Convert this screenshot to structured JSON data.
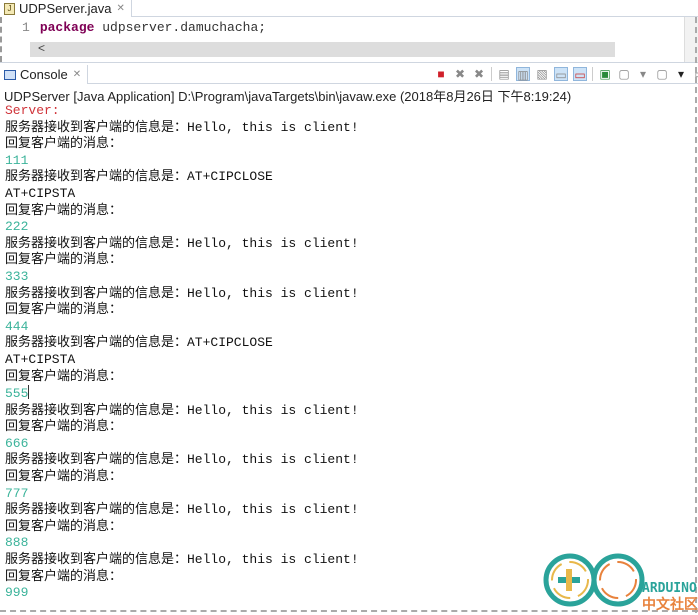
{
  "editor": {
    "tab_label": "UDPServer.java",
    "line_number": "1",
    "keyword": "package",
    "code_rest": " udpserver.damuchacha;",
    "scroll_left": "<"
  },
  "console": {
    "tab_label": "Console",
    "launch_info": "UDPServer [Java Application] D:\\Program\\javaTargets\\bin\\javaw.exe (2018年8月26日 下午8:19:24)",
    "toolbar": [
      "terminate",
      "remove-launch",
      "remove-all",
      "clear-console",
      "scroll-lock",
      "word-wrap",
      "show-on-stdout",
      "show-on-stderr",
      "pin-console",
      "display-selected-console",
      "open-console"
    ],
    "lines": [
      {
        "text": "Server:",
        "kind": "red"
      },
      {
        "text": "服务器接收到客户端的信息是：Hello, this is client!",
        "kind": "out"
      },
      {
        "text": "回复客户端的消息：",
        "kind": "out"
      },
      {
        "text": "111",
        "kind": "in"
      },
      {
        "text": "服务器接收到客户端的信息是：AT+CIPCLOSE",
        "kind": "out"
      },
      {
        "text": "AT+CIPSTA",
        "kind": "out"
      },
      {
        "text": "回复客户端的消息：",
        "kind": "out"
      },
      {
        "text": "222",
        "kind": "in"
      },
      {
        "text": "服务器接收到客户端的信息是：Hello, this is client!",
        "kind": "out"
      },
      {
        "text": "回复客户端的消息：",
        "kind": "out"
      },
      {
        "text": "333",
        "kind": "in"
      },
      {
        "text": "服务器接收到客户端的信息是：Hello, this is client!",
        "kind": "out"
      },
      {
        "text": "回复客户端的消息：",
        "kind": "out"
      },
      {
        "text": "444",
        "kind": "in"
      },
      {
        "text": "服务器接收到客户端的信息是：AT+CIPCLOSE",
        "kind": "out"
      },
      {
        "text": "AT+CIPSTA",
        "kind": "out"
      },
      {
        "text": "回复客户端的消息：",
        "kind": "out"
      },
      {
        "text": "555",
        "kind": "in",
        "cursor": true
      },
      {
        "text": "服务器接收到客户端的信息是：Hello, this is client!",
        "kind": "out"
      },
      {
        "text": "回复客户端的消息：",
        "kind": "out"
      },
      {
        "text": "666",
        "kind": "in"
      },
      {
        "text": "服务器接收到客户端的信息是：Hello, this is client!",
        "kind": "out"
      },
      {
        "text": "回复客户端的消息：",
        "kind": "out"
      },
      {
        "text": "777",
        "kind": "in"
      },
      {
        "text": "服务器接收到客户端的信息是：Hello, this is client!",
        "kind": "out"
      },
      {
        "text": "回复客户端的消息：",
        "kind": "out"
      },
      {
        "text": "888",
        "kind": "in"
      },
      {
        "text": "服务器接收到客户端的信息是：Hello, this is client!",
        "kind": "out"
      },
      {
        "text": "回复客户端的消息：",
        "kind": "out"
      },
      {
        "text": "999",
        "kind": "in"
      }
    ]
  },
  "watermark": {
    "line1": "ARDUINO",
    "line2": "中文社区"
  },
  "colors": {
    "error": "#d0343a",
    "input": "#3bb39a",
    "keyword": "#7f0055"
  }
}
